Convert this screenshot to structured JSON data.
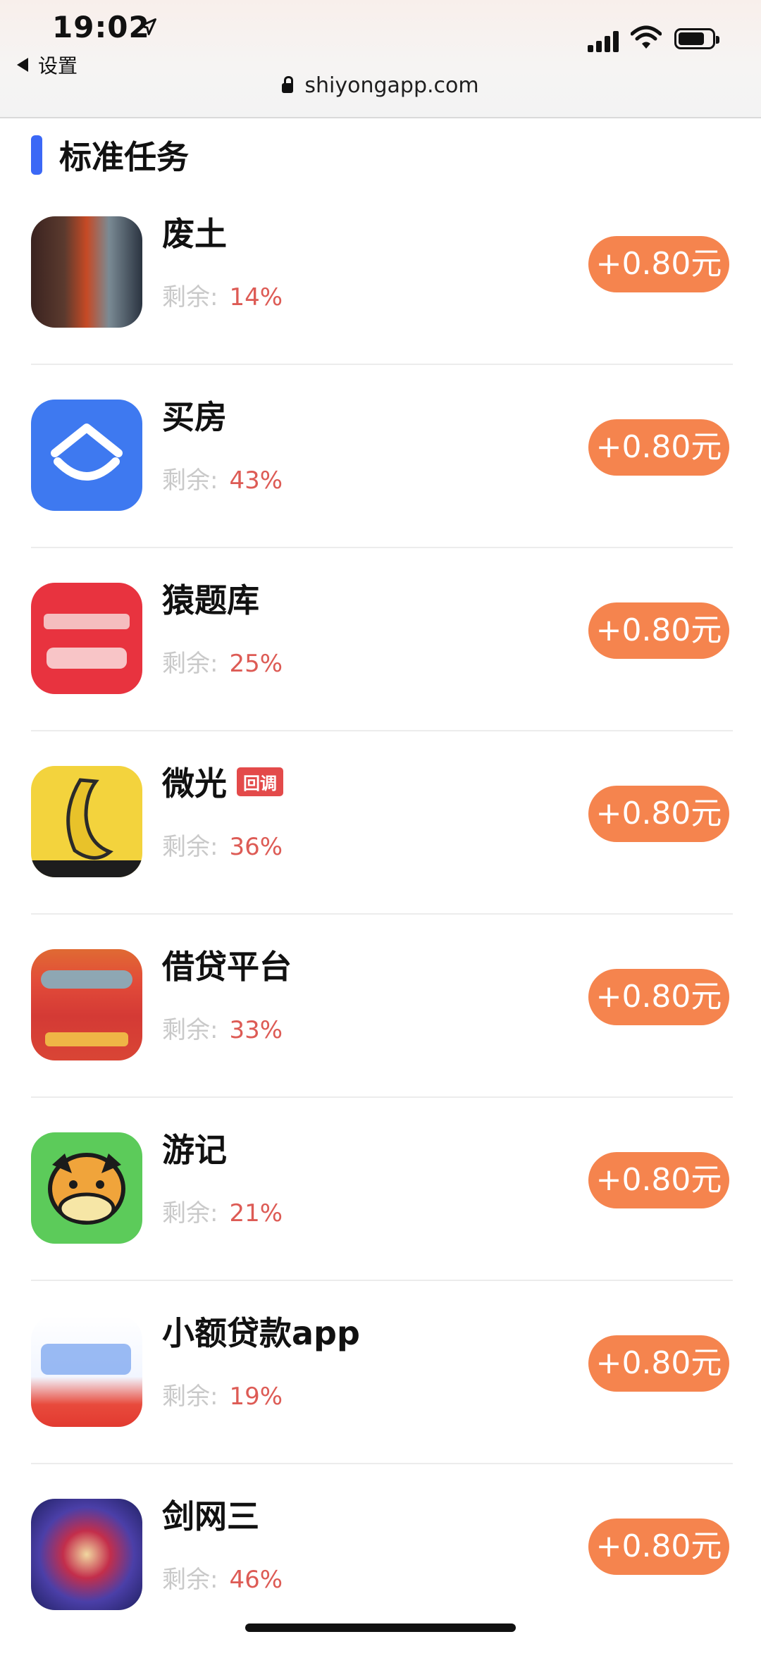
{
  "status_bar": {
    "time": "19:02",
    "back_label": "设置",
    "url": "shiyongapp.com"
  },
  "section": {
    "title": "标准任务"
  },
  "labels": {
    "remain_label": "剩余:"
  },
  "tasks": [
    {
      "name": "废土",
      "remaining": "14%",
      "reward": "+0.80元",
      "icon": "app-icon-feitu"
    },
    {
      "name": "买房",
      "remaining": "43%",
      "reward": "+0.80元",
      "icon": "app-icon-maifang"
    },
    {
      "name": "猿题库",
      "remaining": "25%",
      "reward": "+0.80元",
      "icon": "app-icon-yuantiku"
    },
    {
      "name": "微光",
      "tag": "回调",
      "remaining": "36%",
      "reward": "+0.80元",
      "icon": "app-icon-weiguang"
    },
    {
      "name": "借贷平台",
      "remaining": "33%",
      "reward": "+0.80元",
      "icon": "app-icon-jiedai"
    },
    {
      "name": "游记",
      "remaining": "21%",
      "reward": "+0.80元",
      "icon": "app-icon-youji"
    },
    {
      "name": "小额贷款app",
      "remaining": "19%",
      "reward": "+0.80元",
      "icon": "app-icon-xiaoe"
    },
    {
      "name": "剑网三",
      "remaining": "46%",
      "reward": "+0.80元",
      "icon": "app-icon-jianwang"
    }
  ],
  "colors": {
    "accent_bar": "#3b68f6",
    "reward_button": "#f5844e",
    "percent_text": "#dd5b55",
    "tag_bg": "#e34a4a"
  }
}
